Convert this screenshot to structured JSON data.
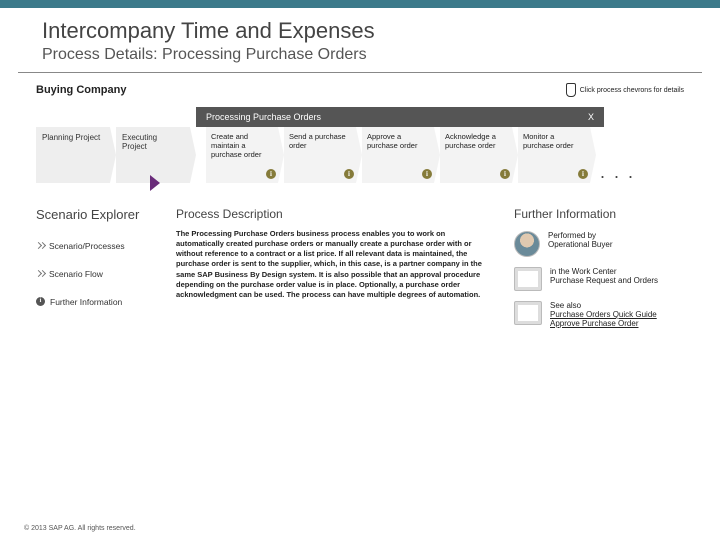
{
  "header": {
    "title": "Intercompany Time and Expenses",
    "subtitle": "Process Details: Processing Purchase Orders"
  },
  "hint": {
    "buying_company": "Buying Company",
    "click_hint": "Click process chevrons for details"
  },
  "expanded": {
    "label": "Processing Purchase Orders",
    "close": "X"
  },
  "pre_steps": [
    {
      "label": "Planning Project"
    },
    {
      "label": "Executing Project"
    }
  ],
  "sub_steps": [
    {
      "label": "Create and maintain a purchase order"
    },
    {
      "label": "Send a purchase order"
    },
    {
      "label": "Approve a purchase order"
    },
    {
      "label": "Acknowledge a purchase order"
    },
    {
      "label": "Monitor a purchase order"
    }
  ],
  "dots": ". . .",
  "scenario_explorer": {
    "title": "Scenario Explorer",
    "nav": [
      "Scenario/Processes",
      "Scenario Flow",
      "Further Information"
    ]
  },
  "process_description": {
    "heading": "Process Description",
    "body": "The Processing Purchase Orders business process enables you to work on automatically created purchase orders or manually create a purchase order with or without reference to a contract or a list price.\nIf all relevant data is maintained, the purchase order is sent to the supplier, which, in this case, is a partner company in the same SAP Business By Design system. It is also possible that an approval procedure depending on the purchase order value is in place. Optionally, a purchase order acknowledgment can be used. The process can have multiple degrees of automation."
  },
  "further_info": {
    "heading": "Further Information",
    "items": [
      {
        "line1": "Performed by",
        "line2": "Operational Buyer",
        "thumb": "avatar"
      },
      {
        "line1": "in the Work Center",
        "line2": "Purchase Request and Orders",
        "thumb": "screen"
      },
      {
        "line1": "See also",
        "links": [
          "Purchase Orders Quick Guide",
          "Approve Purchase Order"
        ],
        "thumb": "screen"
      }
    ]
  },
  "copyright": "© 2013 SAP AG. All rights reserved."
}
